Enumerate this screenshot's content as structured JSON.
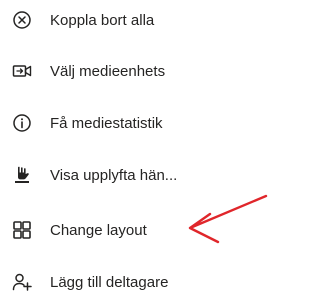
{
  "menu": {
    "items": [
      {
        "label": "Koppla bort alla",
        "icon": "close-circle-icon"
      },
      {
        "label": "Välj medieenhets",
        "icon": "media-device-icon"
      },
      {
        "label": "Få mediestatistik",
        "icon": "info-circle-icon"
      },
      {
        "label": "Visa upplyfta hän...",
        "icon": "raised-hand-icon"
      },
      {
        "label": "Change layout",
        "icon": "grid-layout-icon"
      },
      {
        "label": "Lägg till deltagare",
        "icon": "add-person-icon"
      }
    ]
  },
  "annotation": {
    "arrow_color": "#e0262b",
    "arrow_icon": "red-arrow-icon"
  }
}
